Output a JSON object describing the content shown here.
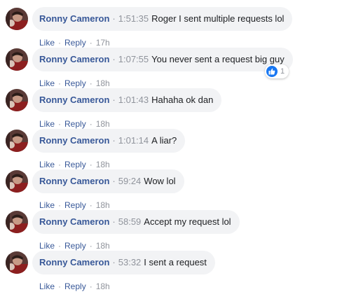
{
  "colors": {
    "author": "#385898",
    "meta": "#90949c",
    "text": "#1c1e21",
    "bubble": "#f2f3f5",
    "like_blue": "#1877f2"
  },
  "comments": [
    {
      "author": "Ronny Cameron",
      "separator": "·",
      "timecode": "1:51:35",
      "text": "Roger I sent multiple requests lol",
      "like_label": "Like",
      "reply_label": "Reply",
      "dot": "·",
      "age": "17h"
    },
    {
      "author": "Ronny Cameron",
      "separator": "·",
      "timecode": "1:07:55",
      "text": "You never sent a request big guy",
      "like_label": "Like",
      "reply_label": "Reply",
      "dot": "·",
      "age": "18h",
      "reaction": {
        "icon": "thumbs-up-icon",
        "count": "1"
      }
    },
    {
      "author": "Ronny Cameron",
      "separator": "·",
      "timecode": "1:01:43",
      "text": "Hahaha ok dan",
      "like_label": "Like",
      "reply_label": "Reply",
      "dot": "·",
      "age": "18h"
    },
    {
      "author": "Ronny Cameron",
      "separator": "·",
      "timecode": "1:01:14",
      "text": "A liar?",
      "like_label": "Like",
      "reply_label": "Reply",
      "dot": "·",
      "age": "18h"
    },
    {
      "author": "Ronny Cameron",
      "separator": "·",
      "timecode": "59:24",
      "text": "Wow lol",
      "like_label": "Like",
      "reply_label": "Reply",
      "dot": "·",
      "age": "18h"
    },
    {
      "author": "Ronny Cameron",
      "separator": "·",
      "timecode": "58:59",
      "text": "Accept my request lol",
      "like_label": "Like",
      "reply_label": "Reply",
      "dot": "·",
      "age": "18h"
    },
    {
      "author": "Ronny Cameron",
      "separator": "·",
      "timecode": "53:32",
      "text": "I sent a request",
      "like_label": "Like",
      "reply_label": "Reply",
      "dot": "·",
      "age": "18h"
    }
  ]
}
